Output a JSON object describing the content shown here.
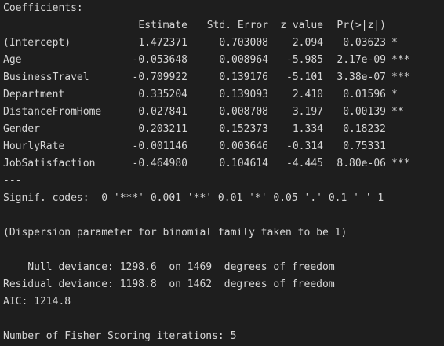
{
  "output": {
    "section_title": "Coefficients:",
    "table": {
      "headers": [
        "Estimate",
        "Std. Error",
        "z value",
        "Pr(>|z|)"
      ],
      "rows": [
        {
          "term": "(Intercept)",
          "estimate": "1.472371",
          "std_error": "0.703008",
          "z_value": "2.094",
          "p_value": "0.03623",
          "sig": "*"
        },
        {
          "term": "Age",
          "estimate": "-0.053648",
          "std_error": "0.008964",
          "z_value": "-5.985",
          "p_value": "2.17e-09",
          "sig": "***"
        },
        {
          "term": "BusinessTravel",
          "estimate": "-0.709922",
          "std_error": "0.139176",
          "z_value": "-5.101",
          "p_value": "3.38e-07",
          "sig": "***"
        },
        {
          "term": "Department",
          "estimate": "0.335204",
          "std_error": "0.139093",
          "z_value": "2.410",
          "p_value": "0.01596",
          "sig": "*"
        },
        {
          "term": "DistanceFromHome",
          "estimate": "0.027841",
          "std_error": "0.008708",
          "z_value": "3.197",
          "p_value": "0.00139",
          "sig": "**"
        },
        {
          "term": "Gender",
          "estimate": "0.203211",
          "std_error": "0.152373",
          "z_value": "1.334",
          "p_value": "0.18232",
          "sig": ""
        },
        {
          "term": "HourlyRate",
          "estimate": "-0.001146",
          "std_error": "0.003646",
          "z_value": "-0.314",
          "p_value": "0.75331",
          "sig": ""
        },
        {
          "term": "JobSatisfaction",
          "estimate": "-0.464980",
          "std_error": "0.104614",
          "z_value": "-4.445",
          "p_value": "8.80e-06",
          "sig": "***"
        }
      ]
    },
    "separator": "---",
    "signif_codes": "Signif. codes:  0 '***' 0.001 '**' 0.01 '*' 0.05 '.' 0.1 ' ' 1",
    "dispersion": "(Dispersion parameter for binomial family taken to be 1)",
    "null_deviance": "    Null deviance: 1298.6  on 1469  degrees of freedom",
    "residual_deviance": "Residual deviance: 1198.8  on 1462  degrees of freedom",
    "aic": "AIC: 1214.8",
    "fisher_iterations": "Number of Fisher Scoring iterations: 5"
  },
  "colors": {
    "background": "#1e1e1e",
    "text": "#d6d6d6"
  }
}
